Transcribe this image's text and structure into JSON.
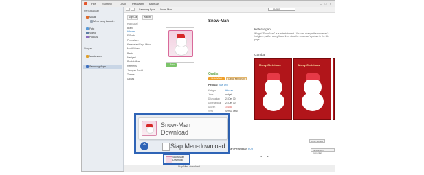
{
  "menu": [
    "File",
    "Sunting",
    "Lihat",
    "Peralatan",
    "Bantuan"
  ],
  "sidebar": {
    "section1": "Perpustakaan",
    "items": [
      "Musik",
      "Merk yang baru di...",
      "Foto",
      "Video",
      "Podcast"
    ],
    "section2": "Simpan",
    "stores": [
      "Music store",
      "Samsung Apps"
    ]
  },
  "breadcrumb": {
    "store": "Samsung Apps",
    "item": "Snow-Man"
  },
  "search": {
    "value": "SM500"
  },
  "categories": {
    "tabs": [
      "Sign Out",
      "Wishlist"
    ],
    "title": "Kategori",
    "items": [
      "Brand",
      "Hiburan",
      "E-Book",
      "Permainan",
      "Kesehatan/Gaya Hidup",
      "Musik/Video",
      "Berita",
      "Navigasi",
      "Produktifitas",
      "Referensi",
      "Jaringan Sosial",
      "Theme",
      "Utilitas"
    ],
    "active_index": 1
  },
  "app": {
    "name": "Snow-Man",
    "badge": "Baru",
    "price": "Gratis",
    "download_button": "Unduh/Beli",
    "wishlist_button": "Daftar Keinginan",
    "seller_label": "Penjual",
    "seller_value": "SMI DST",
    "meta": [
      {
        "k": "Kategori",
        "v": "Hiburan"
      },
      {
        "k": "Jenis",
        "v": "widget"
      },
      {
        "k": "Diluncurkan",
        "v": "24 Des 10"
      },
      {
        "k": "Diperbaharui",
        "v": "24 Des 10"
      },
      {
        "k": "Ukuran",
        "v": "316kB"
      },
      {
        "k": "Versi",
        "v": "Semua versi"
      }
    ],
    "desc_title": "Keterangan",
    "description": "Widget \"Snow-Man\" is a entertainment . You can change the snowman's hat,glove,muffler and gift and then view the snowman's picture in the title page.",
    "gambar_title": "Gambar",
    "screenshot_label": "Merry Christmas",
    "see_all": "Lihat Semua",
    "reviews_label": "lasan Pelanggan",
    "reviews_count": "( 0 )",
    "write_review": "Tambahkan Komentar",
    "also_label": "Telepon Saya"
  },
  "popup": {
    "name": "Snow-Man",
    "subtitle": "Download",
    "status": "Siap Men-download"
  },
  "statusbar": {
    "mini_name": "Snow-Man",
    "mini_sub": "Download",
    "status": "Siap Men-download"
  }
}
